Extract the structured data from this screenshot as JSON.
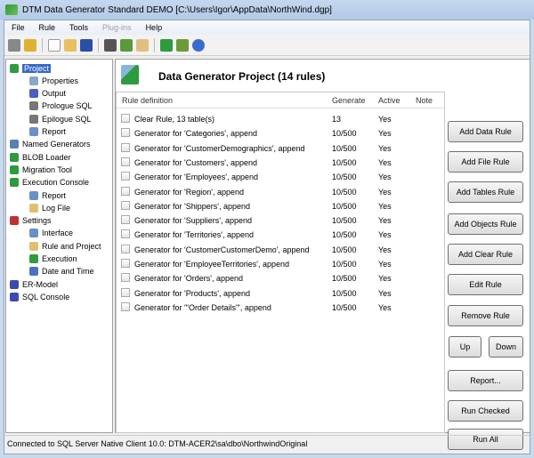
{
  "window": {
    "title": "DTM Data Generator Standard DEMO [C:\\Users\\Igor\\AppData\\NorthWind.dgp]"
  },
  "menu": [
    "File",
    "Rule",
    "Tools",
    "Plug-ins",
    "Help"
  ],
  "tree": [
    {
      "label": "Project",
      "level": 0,
      "selected": true,
      "color": "#2e9b3e"
    },
    {
      "label": "Properties",
      "level": 1,
      "color": "#8aa6c8"
    },
    {
      "label": "Output",
      "level": 1,
      "color": "#4a5fc0"
    },
    {
      "label": "Prologue SQL",
      "level": 1,
      "color": "#777"
    },
    {
      "label": "Epilogue SQL",
      "level": 1,
      "color": "#777"
    },
    {
      "label": "Report",
      "level": 1,
      "color": "#6a90c8"
    },
    {
      "label": "Named Generators",
      "level": 0,
      "color": "#5a7fb0"
    },
    {
      "label": "BLOB Loader",
      "level": 0,
      "color": "#2e9b3e"
    },
    {
      "label": "Migration Tool",
      "level": 0,
      "color": "#2e9b3e"
    },
    {
      "label": "Execution Console",
      "level": 0,
      "color": "#2e9b3e"
    },
    {
      "label": "Report",
      "level": 1,
      "color": "#6a90c8"
    },
    {
      "label": "Log File",
      "level": 1,
      "color": "#e0c070"
    },
    {
      "label": "Settings",
      "level": 0,
      "color": "#c03030"
    },
    {
      "label": "Interface",
      "level": 1,
      "color": "#6a90c8"
    },
    {
      "label": "Rule and Project",
      "level": 1,
      "color": "#e0c070"
    },
    {
      "label": "Execution",
      "level": 1,
      "color": "#2e9b3e"
    },
    {
      "label": "Date and Time",
      "level": 1,
      "color": "#4a70c0"
    },
    {
      "label": "ER-Model",
      "level": 0,
      "color": "#3a4ab0"
    },
    {
      "label": "SQL Console",
      "level": 0,
      "color": "#3a4ab0"
    }
  ],
  "project": {
    "title": "Data Generator Project (14 rules)"
  },
  "table": {
    "headers": [
      "Rule definition",
      "Generate",
      "Active",
      "Note"
    ],
    "rows": [
      [
        "Clear Rule, 13 table(s)",
        "13",
        "Yes",
        ""
      ],
      [
        "Generator for 'Categories', append",
        "10/500",
        "Yes",
        ""
      ],
      [
        "Generator for 'CustomerDemographics', append",
        "10/500",
        "Yes",
        ""
      ],
      [
        "Generator for 'Customers', append",
        "10/500",
        "Yes",
        ""
      ],
      [
        "Generator for 'Employees', append",
        "10/500",
        "Yes",
        ""
      ],
      [
        "Generator for 'Region', append",
        "10/500",
        "Yes",
        ""
      ],
      [
        "Generator for 'Shippers', append",
        "10/500",
        "Yes",
        ""
      ],
      [
        "Generator for 'Suppliers', append",
        "10/500",
        "Yes",
        ""
      ],
      [
        "Generator for 'Territories', append",
        "10/500",
        "Yes",
        ""
      ],
      [
        "Generator for 'CustomerCustomerDemo', append",
        "10/500",
        "Yes",
        ""
      ],
      [
        "Generator for 'EmployeeTerritories', append",
        "10/500",
        "Yes",
        ""
      ],
      [
        "Generator for 'Orders', append",
        "10/500",
        "Yes",
        ""
      ],
      [
        "Generator for 'Products', append",
        "10/500",
        "Yes",
        ""
      ],
      [
        "Generator for '\"Order Details\"', append",
        "10/500",
        "Yes",
        ""
      ]
    ]
  },
  "buttons": {
    "add_data_rule": "Add Data Rule",
    "add_file_rule": "Add File Rule",
    "add_tables_rule": "Add Tables Rule",
    "add_objects_rule": "Add Objects Rule",
    "add_clear_rule": "Add Clear Rule",
    "edit_rule": "Edit Rule",
    "remove_rule": "Remove Rule",
    "up": "Up",
    "down": "Down",
    "report": "Report...",
    "run_checked": "Run Checked",
    "run_all": "Run All"
  },
  "status": "Connected to SQL Server Native Client 10.0: DTM-ACER2\\sa\\dbo\\NorthwindOriginal"
}
